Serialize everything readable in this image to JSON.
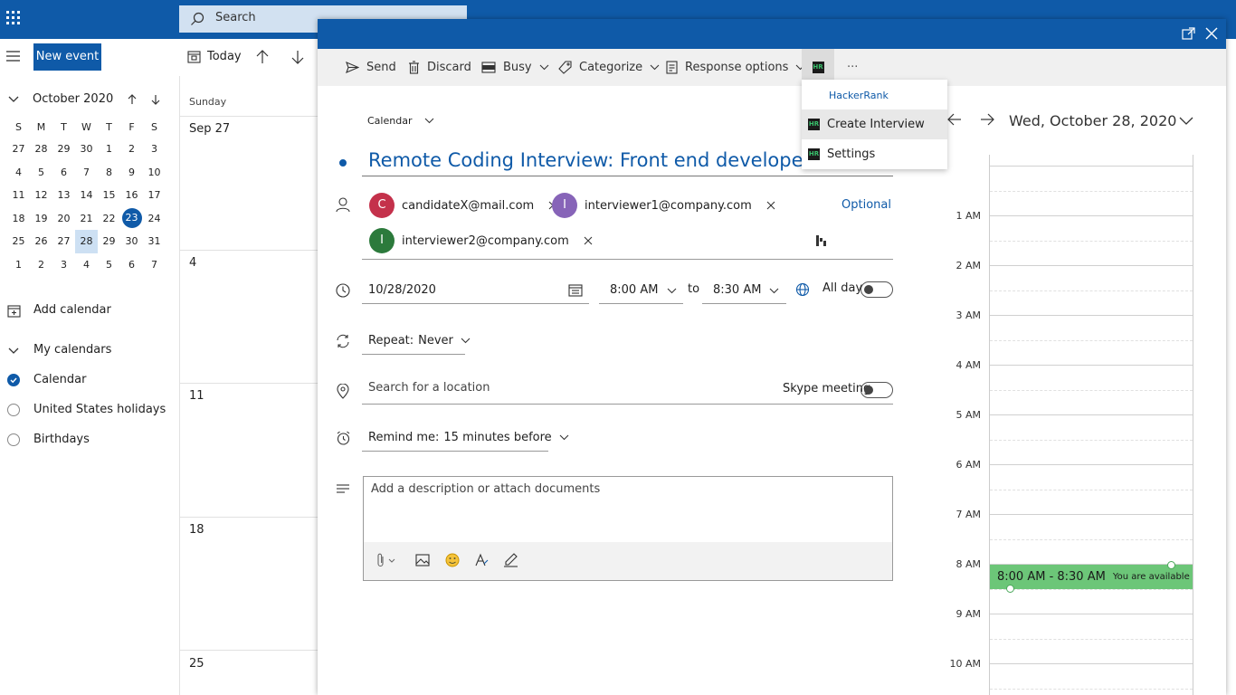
{
  "topbar": {
    "search_placeholder": "Search"
  },
  "left": {
    "new_event": "New event",
    "month_title": "October 2020",
    "weekdays": [
      "S",
      "M",
      "T",
      "W",
      "T",
      "F",
      "S"
    ],
    "weeks": [
      [
        "27",
        "28",
        "29",
        "30",
        "1",
        "2",
        "3"
      ],
      [
        "4",
        "5",
        "6",
        "7",
        "8",
        "9",
        "10"
      ],
      [
        "11",
        "12",
        "13",
        "14",
        "15",
        "16",
        "17"
      ],
      [
        "18",
        "19",
        "20",
        "21",
        "22",
        "23",
        "24"
      ],
      [
        "25",
        "26",
        "27",
        "28",
        "29",
        "30",
        "31"
      ],
      [
        "1",
        "2",
        "3",
        "4",
        "5",
        "6",
        "7"
      ]
    ],
    "add_calendar": "Add calendar",
    "my_calendars": "My calendars",
    "calendars": [
      "Calendar",
      "United States holidays",
      "Birthdays"
    ]
  },
  "grid": {
    "today": "Today",
    "day_header": "Sunday",
    "dates": [
      "Sep 27",
      "4",
      "11",
      "18",
      "25"
    ]
  },
  "toolbar": {
    "send": "Send",
    "discard": "Discard",
    "busy": "Busy",
    "categorize": "Categorize",
    "response": "Response options",
    "more": "···"
  },
  "hr_menu": {
    "header": "HackerRank",
    "create": "Create Interview",
    "settings": "Settings",
    "icon_text": "HR"
  },
  "form": {
    "calendar_label": "Calendar",
    "title": "Remote Coding Interview: Front end developer role",
    "attendees": [
      {
        "initial": "C",
        "email": "candidateX@mail.com",
        "color": "#c4314b"
      },
      {
        "initial": "I",
        "email": "interviewer1@company.com",
        "color": "#8764b8"
      },
      {
        "initial": "I",
        "email": "interviewer2@company.com",
        "color": "#2c7a3c"
      }
    ],
    "optional": "Optional",
    "date": "10/28/2020",
    "start_time": "8:00 AM",
    "to": "to",
    "end_time": "8:30 AM",
    "all_day": "All day",
    "repeat_label": "Repeat:",
    "repeat_value": "Never",
    "location_placeholder": "Search for a location",
    "skype": "Skype meeting",
    "remind_label": "Remind me:",
    "remind_value": "15 minutes before",
    "description_placeholder": "Add a description or attach documents"
  },
  "day_view": {
    "date": "Wed, October 28, 2020",
    "hours": [
      "1 AM",
      "2 AM",
      "3 AM",
      "4 AM",
      "5 AM",
      "6 AM",
      "7 AM",
      "8 AM",
      "9 AM",
      "10 AM"
    ],
    "event_time": "8:00 AM - 8:30 AM",
    "event_note": "You are available"
  },
  "colors": {
    "brand": "#0f5aa8",
    "event": "#6cc678"
  }
}
